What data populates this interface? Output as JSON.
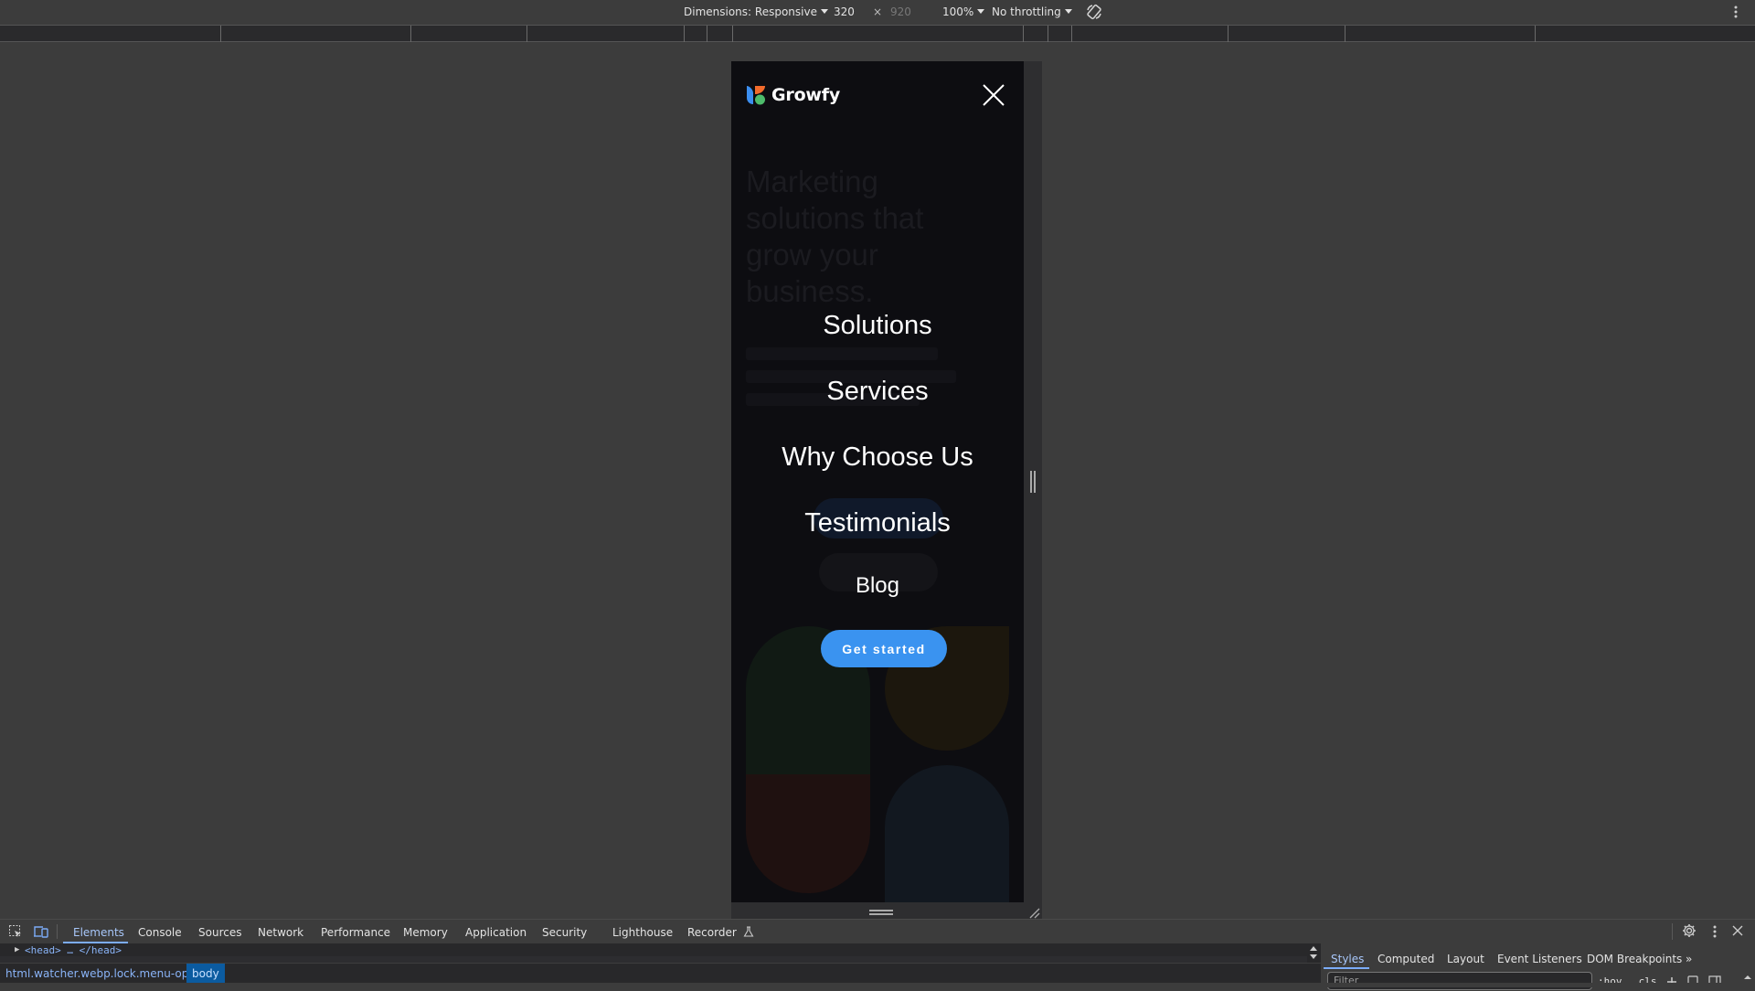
{
  "device_toolbar": {
    "dimensions_label": "Dimensions: Responsive",
    "width": "320",
    "times": "×",
    "height": "920",
    "zoom": "100%",
    "throttling": "No throttling"
  },
  "page": {
    "brand": "Growfy",
    "logo_colors": {
      "blue": "#3b8ef0",
      "orange": "#f26b2c",
      "green": "#4dbb6b"
    },
    "hero_text": "Marketing solutions that grow your business.",
    "menu": {
      "items": [
        {
          "label": "Solutions"
        },
        {
          "label": "Services"
        },
        {
          "label": "Why Choose Us"
        },
        {
          "label": "Testimonials"
        },
        {
          "label": "Blog"
        }
      ],
      "cta_label": "Get started",
      "cta_color": "#3a93f0"
    }
  },
  "devtools": {
    "tabs": [
      {
        "label": "Elements",
        "active": true
      },
      {
        "label": "Console"
      },
      {
        "label": "Sources"
      },
      {
        "label": "Network"
      },
      {
        "label": "Performance"
      },
      {
        "label": "Memory"
      },
      {
        "label": "Application"
      },
      {
        "label": "Security"
      },
      {
        "label": "Lighthouse"
      },
      {
        "label": "Recorder"
      }
    ],
    "elements_line": "<head> … </head>",
    "breadcrumb": [
      {
        "label": "html.watcher.webp.lock.menu-open"
      },
      {
        "label": "body",
        "selected": true
      }
    ],
    "side_tabs": [
      {
        "label": "Styles",
        "active": true
      },
      {
        "label": "Computed"
      },
      {
        "label": "Layout"
      },
      {
        "label": "Event Listeners"
      },
      {
        "label": "DOM Breakpoints"
      }
    ],
    "more_tabs": "»",
    "filter_placeholder": "Filter",
    "hov_label": ":hov",
    "cls_label": ".cls"
  }
}
